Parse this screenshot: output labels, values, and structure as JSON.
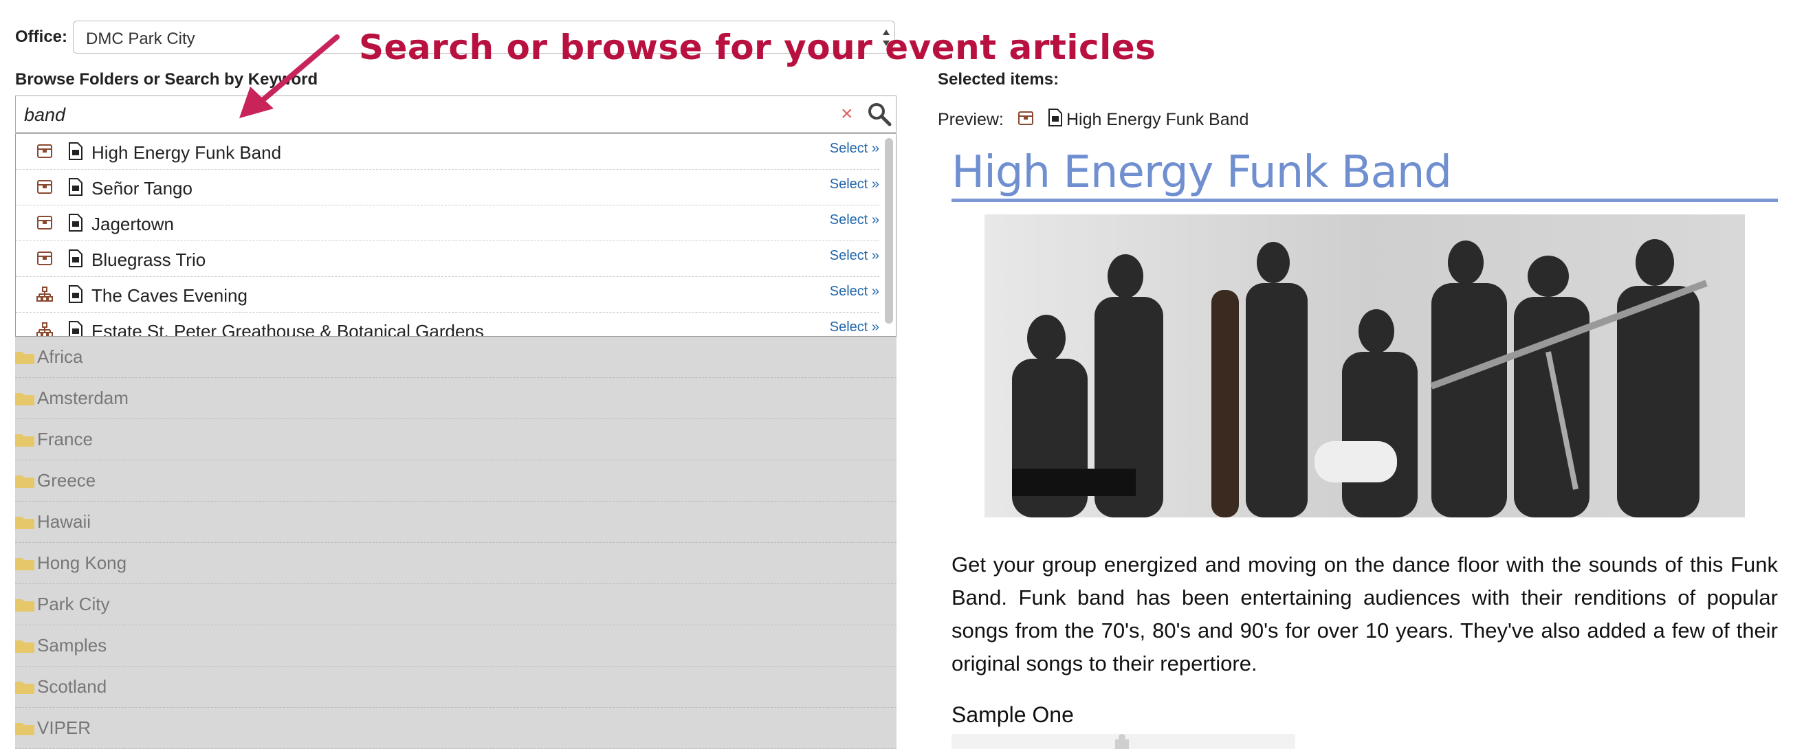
{
  "office": {
    "label": "Office:",
    "value": "DMC Park City"
  },
  "callout": "Search or browse for your event articles",
  "browse": {
    "label": "Browse Folders or Search by Keyword"
  },
  "search": {
    "value": "band",
    "clear": "×"
  },
  "results": [
    {
      "name": "High Energy Funk Band",
      "type": "package",
      "select": "Select »"
    },
    {
      "name": "Señor Tango",
      "type": "package",
      "select": "Select »"
    },
    {
      "name": "Jagertown",
      "type": "package",
      "select": "Select »"
    },
    {
      "name": "Bluegrass Trio",
      "type": "package",
      "select": "Select »"
    },
    {
      "name": "The Caves Evening",
      "type": "sitemap",
      "select": "Select »"
    },
    {
      "name": "Estate St. Peter Greathouse & Botanical Gardens",
      "type": "sitemap",
      "select": "Select »"
    }
  ],
  "folders": [
    "Africa",
    "Amsterdam",
    "France",
    "Greece",
    "Hawaii",
    "Hong Kong",
    "Park City",
    "Samples",
    "Scotland",
    "VIPER"
  ],
  "selected": {
    "label": "Selected items:",
    "preview_label": "Preview:",
    "preview_name": "High Energy Funk Band"
  },
  "article": {
    "title": "High Energy Funk Band",
    "body": "Get your group energized and moving on the dance floor with the sounds of this Funk Band. Funk band has been entertaining audiences with their renditions of popular songs from the 70's, 80's and 90's for over 10 years. They've also added a few of their original songs to their repertiore.",
    "sample_label": "Sample One"
  },
  "colors": {
    "accent_callout": "#b8103f",
    "title_blue": "#6f8fd0",
    "link_blue": "#2266aa",
    "package_brown": "#8a4a30"
  }
}
